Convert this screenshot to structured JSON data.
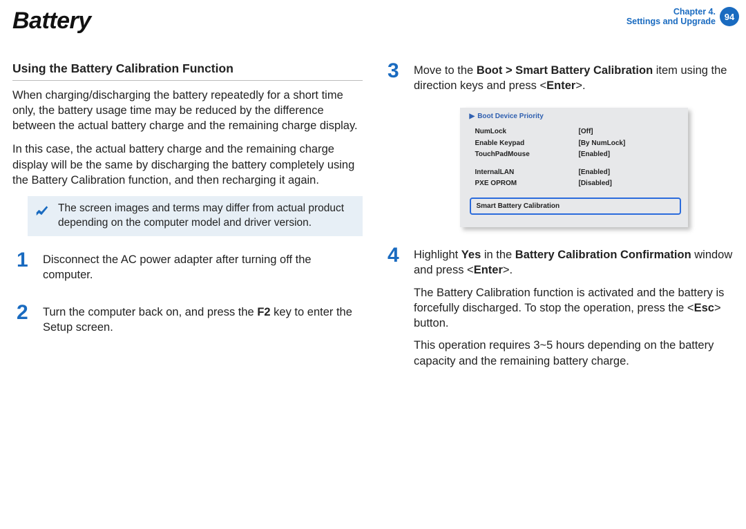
{
  "header": {
    "title": "Battery",
    "chapter_line1": "Chapter 4.",
    "chapter_line2": "Settings and Upgrade",
    "page_number": "94"
  },
  "left": {
    "section_heading": "Using the Battery Calibration Function",
    "para1": "When charging/discharging the battery repeatedly for a short time only, the battery usage time may be reduced by the difference between the actual battery charge and the remaining charge display.",
    "para2": "In this case, the actual battery charge and the remaining charge display will be the same by discharging the battery completely using the Battery Calibration function, and then recharging it again.",
    "note": "The screen images and terms may differ from actual product depending on the computer model and driver version.",
    "step1_num": "1",
    "step1_text": "Disconnect the AC power adapter after turning off the computer.",
    "step2_num": "2",
    "step2_pre": "Turn the computer back on, and press the ",
    "step2_key": "F2",
    "step2_post": " key to enter the Setup screen."
  },
  "right": {
    "step3_num": "3",
    "step3_pre": "Move to the ",
    "step3_bold": "Boot > Smart Battery Calibration",
    "step3_mid": " item using the direction keys and press <",
    "step3_enter": "Enter",
    "step3_post": ">.",
    "bios": {
      "header_arrow": "▶",
      "header_text": "Boot Device Priority",
      "rows1": [
        {
          "k": "NumLock",
          "v": "[Off]"
        },
        {
          "k": "Enable Keypad",
          "v": "[By NumLock]"
        },
        {
          "k": "TouchPadMouse",
          "v": "[Enabled]"
        }
      ],
      "rows2": [
        {
          "k": "InternalLAN",
          "v": "[Enabled]"
        },
        {
          "k": "PXE OPROM",
          "v": "[Disabled]"
        }
      ],
      "highlight": "Smart Battery Calibration"
    },
    "step4_num": "4",
    "step4_l1_pre": "Highlight ",
    "step4_l1_yes": "Yes",
    "step4_l1_mid": " in the ",
    "step4_l1_bold": "Battery Calibration Confirmation",
    "step4_l1_post1": " window and press <",
    "step4_l1_enter": "Enter",
    "step4_l1_post2": ">.",
    "step4_p2_pre": "The Battery Calibration function is activated and the battery is forcefully discharged. To stop the operation, press the <",
    "step4_p2_esc": "Esc",
    "step4_p2_post": "> button.",
    "step4_p3": "This operation requires 3~5 hours depending on the battery capacity and the remaining battery charge."
  }
}
